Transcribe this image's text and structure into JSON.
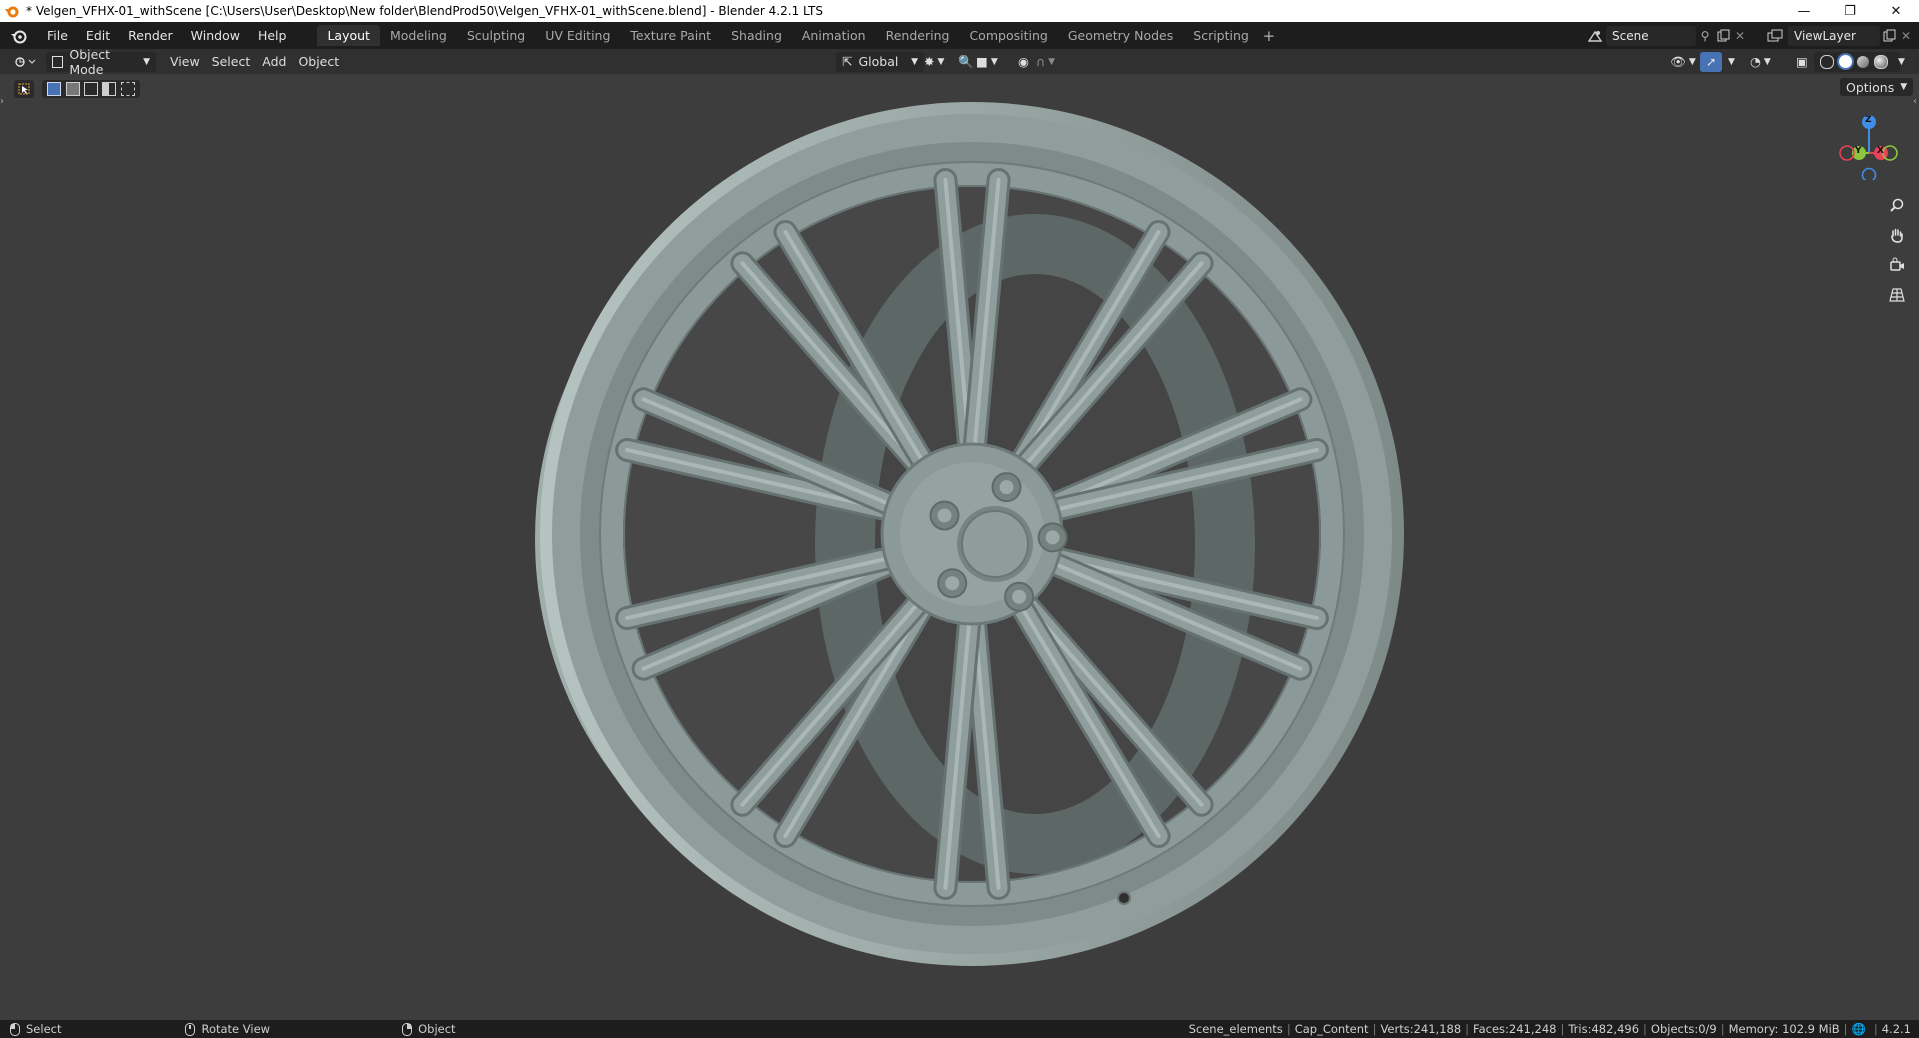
{
  "window": {
    "title": "* Velgen_VFHX-01_withScene [C:\\Users\\User\\Desktop\\New folder\\BlendProd50\\Velgen_VFHX-01_withScene.blend] - Blender 4.2.1 LTS",
    "app_icon": "blender-icon",
    "controls": [
      "minimize-icon",
      "restore-icon",
      "close-icon"
    ]
  },
  "menu": {
    "items": [
      {
        "label": "File"
      },
      {
        "label": "Edit"
      },
      {
        "label": "Render"
      },
      {
        "label": "Window"
      },
      {
        "label": "Help"
      }
    ]
  },
  "workspaces": {
    "tabs": [
      {
        "label": "Layout",
        "active": true
      },
      {
        "label": "Modeling"
      },
      {
        "label": "Sculpting"
      },
      {
        "label": "UV Editing"
      },
      {
        "label": "Texture Paint"
      },
      {
        "label": "Shading"
      },
      {
        "label": "Animation"
      },
      {
        "label": "Rendering"
      },
      {
        "label": "Compositing"
      },
      {
        "label": "Geometry Nodes"
      },
      {
        "label": "Scripting"
      }
    ],
    "add_symbol": "+"
  },
  "scene": {
    "name": "Scene"
  },
  "view_layer": {
    "name": "ViewLayer"
  },
  "viewport_header": {
    "mode": "Object Mode",
    "menus": [
      {
        "label": "View"
      },
      {
        "label": "Select"
      },
      {
        "label": "Add"
      },
      {
        "label": "Object"
      }
    ],
    "transform_orientation": "Global",
    "options_label": "Options"
  },
  "status": {
    "hints": [
      {
        "label": "Select",
        "icon": "mouse-left-icon"
      },
      {
        "label": "Rotate View",
        "icon": "mouse-middle-icon"
      },
      {
        "label": "Object",
        "icon": "mouse-right-icon"
      }
    ],
    "collection": "Scene_elements",
    "active_object": "Cap_Content",
    "verts": "Verts:241,188",
    "faces": "Faces:241,248",
    "tris": "Tris:482,496",
    "objects": "Objects:0/9",
    "memory": "Memory: 102.9 MiB",
    "version": "4.2.1"
  },
  "gizmo": {
    "axes": [
      "Z",
      "Y",
      "X"
    ]
  },
  "colors": {
    "accent": "#4772b3",
    "background": "#3d3d3d",
    "axis_x": "#e84158",
    "axis_y": "#8cc63f",
    "axis_z": "#3e8de6",
    "wheel": "#8b9a98"
  }
}
